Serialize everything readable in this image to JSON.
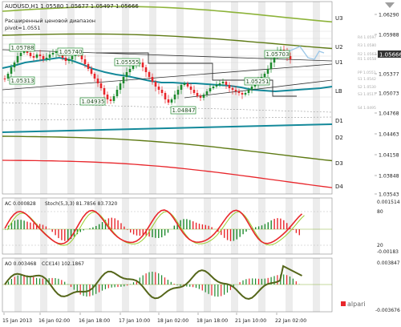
{
  "window": {
    "symbol_line": "AUDUSD,H1  1.05580 1.05677 1.05497 1.05666",
    "indicator_title": "Расширенный ценовой диапазон",
    "pivot_text": "pivot=1.0551"
  },
  "main_chart": {
    "price_ticks": [
      "1.06290",
      "1.05988",
      "1.05666",
      "1.05377",
      "1.05073",
      "1.04768",
      "1.04463",
      "1.04158",
      "1.03848",
      "1.03543"
    ],
    "current_price": "1.05666",
    "level_labels": [
      "U3",
      "U2",
      "U1",
      "LB",
      "D1",
      "D2",
      "D3",
      "D4"
    ],
    "annotations": [
      {
        "text": "1.05788"
      },
      {
        "text": "1.05740"
      },
      {
        "text": "1.05555"
      },
      {
        "text": "1.05313"
      },
      {
        "text": "1.04935"
      },
      {
        "text": "1.04847"
      },
      {
        "text": "1.05251"
      },
      {
        "text": "1.05703"
      }
    ],
    "mini_labels": [
      "R4 1.0597",
      "R3 1.0580",
      "R2 1.0567",
      "R1 1.0558",
      "PP 1.0551",
      "S1 1.0542",
      "S2 1.0530",
      "S3 1.0517",
      "S4 1.0495"
    ]
  },
  "ac_stoch": {
    "label": "AC 0.000828",
    "stoch_label": "Stoch(5,3,3) 81.7856 83.7320",
    "ticks": [
      "0.001514",
      "80",
      "20",
      "-0.00183"
    ]
  },
  "ao_cci": {
    "label": "AO 0.003468",
    "cci_label": "CCI(14) 102.1867",
    "ticks": [
      "0.003847",
      "-0.003676"
    ]
  },
  "time_axis": [
    "15 Jan 2013",
    "16 Jan 02:00",
    "16 Jan 18:00",
    "17 Jan 10:00",
    "18 Jan 02:00",
    "18 Jan 18:00",
    "21 Jan 10:00",
    "22 Jan 02:00"
  ],
  "watermark": "alpari",
  "colors": {
    "u3": "#8db33a",
    "green_band": "#5e7a14",
    "teal": "#14899a",
    "red_line": "#e8262b",
    "black_line": "#333333",
    "bull_candle": "#1d8a2d",
    "bear_candle": "#e8262b",
    "shade": "#e6e6e6",
    "osc_red": "#e8262b",
    "osc_green": "#1d8a2d",
    "osc_olive": "#55661a"
  }
}
